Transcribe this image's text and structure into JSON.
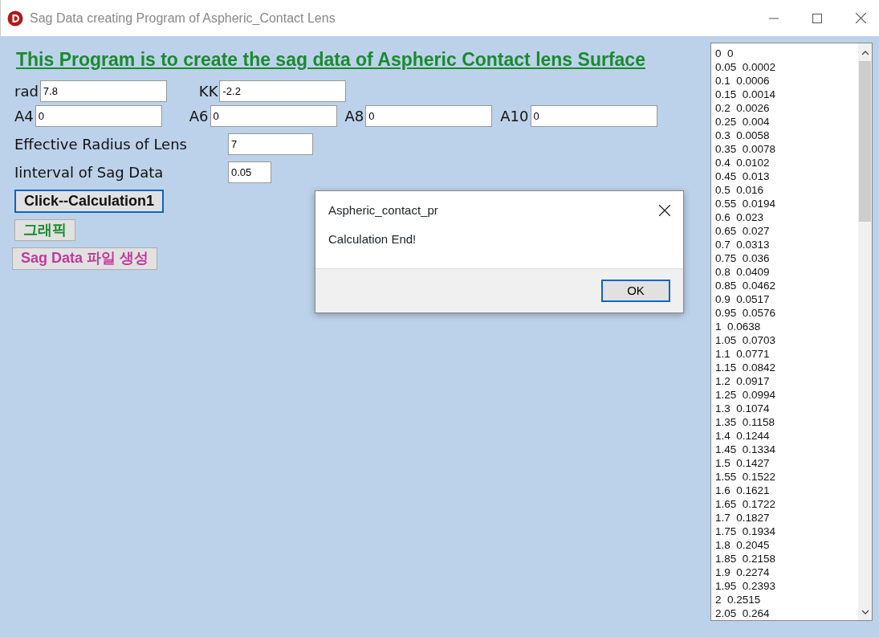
{
  "window": {
    "title": "Sag Data creating Program of Aspheric_Contact Lens"
  },
  "heading": "This Program is to create the sag data of Aspheric Contact lens Surface",
  "coefficient_rows": [
    {
      "fields": [
        {
          "label": "rad",
          "value": "7.8"
        },
        {
          "label": "KK",
          "value": "-2.2"
        }
      ]
    },
    {
      "fields": [
        {
          "label": "A4",
          "value": "0"
        },
        {
          "label": "A6",
          "value": "0"
        },
        {
          "label": "A8",
          "value": "0"
        },
        {
          "label": "A10",
          "value": "0"
        }
      ]
    }
  ],
  "settings": [
    {
      "label": "Effective Radius of Lens",
      "value": "7",
      "kind": "wide"
    },
    {
      "label": "Iinterval of Sag Data",
      "value": "0.05",
      "kind": "narrow"
    }
  ],
  "buttons": [
    {
      "label": "Click--Calculation1",
      "color": "#111111",
      "focused": true
    },
    {
      "label": "그래픽",
      "color": "#1a8a2e",
      "focused": false
    },
    {
      "label": "Sag Data 파일 생성",
      "color": "#c0399a",
      "focused": false
    }
  ],
  "sag_list": [
    "0  0",
    "0.05  0.0002",
    "0.1  0.0006",
    "0.15  0.0014",
    "0.2  0.0026",
    "0.25  0.004",
    "0.3  0.0058",
    "0.35  0.0078",
    "0.4  0.0102",
    "0.45  0.013",
    "0.5  0.016",
    "0.55  0.0194",
    "0.6  0.023",
    "0.65  0.027",
    "0.7  0.0313",
    "0.75  0.036",
    "0.8  0.0409",
    "0.85  0.0462",
    "0.9  0.0517",
    "0.95  0.0576",
    "1  0.0638",
    "1.05  0.0703",
    "1.1  0.0771",
    "1.15  0.0842",
    "1.2  0.0917",
    "1.25  0.0994",
    "1.3  0.1074",
    "1.35  0.1158",
    "1.4  0.1244",
    "1.45  0.1334",
    "1.5  0.1427",
    "1.55  0.1522",
    "1.6  0.1621",
    "1.65  0.1722",
    "1.7  0.1827",
    "1.75  0.1934",
    "1.8  0.2045",
    "1.85  0.2158",
    "1.9  0.2274",
    "1.95  0.2393",
    "2  0.2515",
    "2.05  0.264"
  ],
  "dialog": {
    "title": "Aspheric_contact_pr",
    "message": "Calculation End!",
    "button": "OK"
  }
}
